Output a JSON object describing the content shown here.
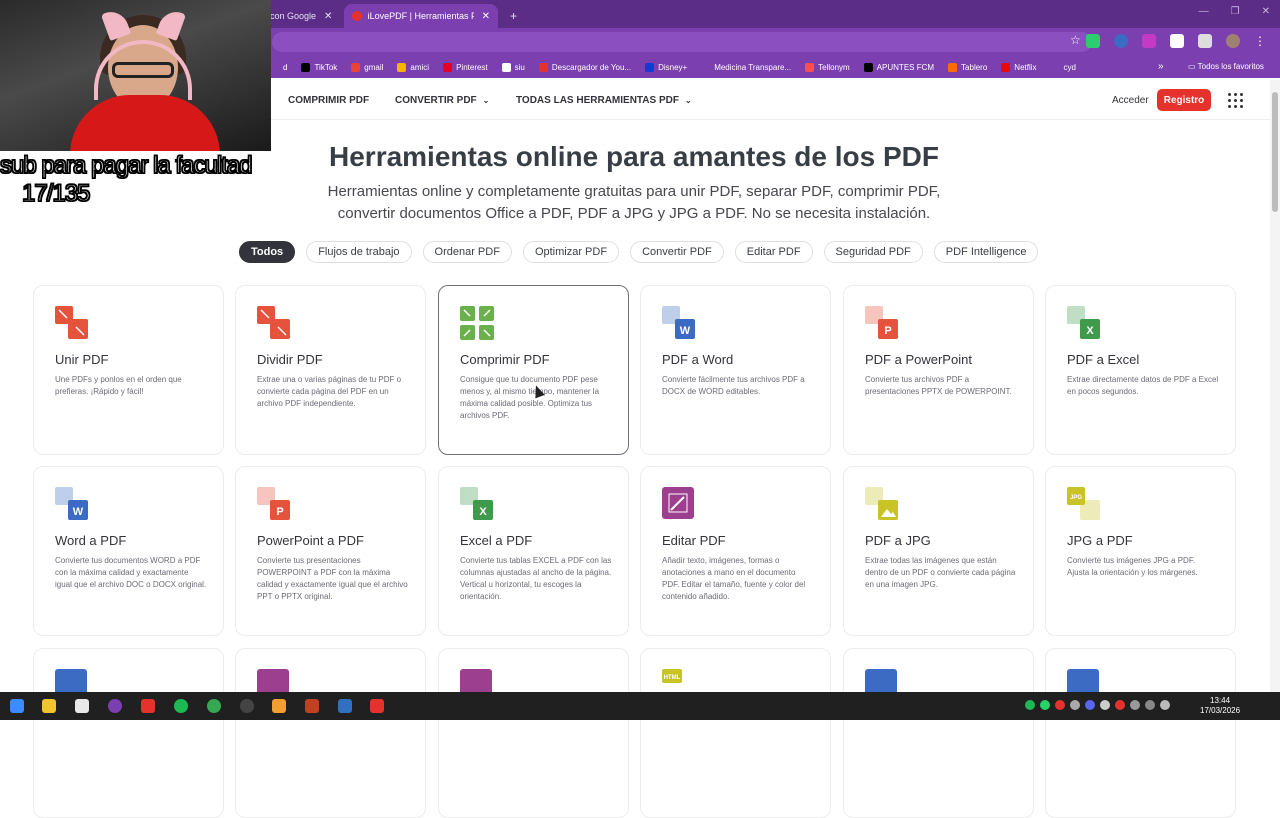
{
  "browser": {
    "tabs": [
      {
        "label": "con Google",
        "active": false
      },
      {
        "label": "iLovePDF | Herramientas PDF o",
        "active": true
      }
    ],
    "new_tab": "+",
    "close": "✕",
    "bookmarks": [
      {
        "label": "d",
        "color": "#7b3fb0"
      },
      {
        "label": "TikTok",
        "color": "#000000"
      },
      {
        "label": "gmail",
        "color": "#ea4335"
      },
      {
        "label": "amici",
        "color": "#f4b400"
      },
      {
        "label": "Pinterest",
        "color": "#e60023"
      },
      {
        "label": "siu",
        "color": "#ffffff"
      },
      {
        "label": "Descargador de You...",
        "color": "#e5322d"
      },
      {
        "label": "Disney+",
        "color": "#113ccf"
      },
      {
        "label": "Medicina Transpare...",
        "color": "#7b3fb0"
      },
      {
        "label": "Tellonym",
        "color": "#ff4d4d"
      },
      {
        "label": "APUNTES FCM",
        "color": "#000000"
      },
      {
        "label": "Tablero",
        "color": "#ff6b00"
      },
      {
        "label": "Netflix",
        "color": "#e50914"
      },
      {
        "label": "cyd",
        "color": "#7b3fb0"
      }
    ],
    "bookmarks_more": "»",
    "all_favorites": "Todos los favoritos"
  },
  "overlay": {
    "line1": "sub para pagar la facultad",
    "line2": "17/135"
  },
  "nav": {
    "compress": "COMPRIMIR PDF",
    "convert": "CONVERTIR PDF",
    "all_tools": "TODAS LAS HERRAMIENTAS PDF",
    "login": "Acceder",
    "register": "Registro"
  },
  "hero": {
    "title": "Herramientas online para amantes de los PDF",
    "subtitle": "Herramientas online y completamente gratuitas para unir PDF, separar PDF, comprimir PDF, convertir documentos Office a PDF, PDF a JPG y JPG a PDF. No se necesita instalación."
  },
  "filters": [
    "Todos",
    "Flujos de trabajo",
    "Ordenar PDF",
    "Optimizar PDF",
    "Convertir PDF",
    "Editar PDF",
    "Seguridad PDF",
    "PDF Intelligence"
  ],
  "tools": [
    {
      "title": "Unir PDF",
      "desc": "Une PDFs y ponlos en el orden que prefieras. ¡Rápido y fácil!",
      "icon": "merge-icon",
      "color": "#e5533d"
    },
    {
      "title": "Dividir PDF",
      "desc": "Extrae una o varias páginas de tu PDF o convierte cada página del PDF en un archivo PDF independiente.",
      "icon": "split-icon",
      "color": "#e5533d"
    },
    {
      "title": "Comprimir PDF",
      "desc": "Consigue que tu documento PDF pese menos y, al mismo tiempo, mantener la máxima calidad posible. Optimiza tus archivos PDF.",
      "icon": "compress-icon",
      "color": "#6ab04c"
    },
    {
      "title": "PDF a Word",
      "desc": "Convierte fácilmente tus archivos PDF a DOCX de WORD editables.",
      "icon": "word-icon",
      "color": "#3b6bc2"
    },
    {
      "title": "PDF a PowerPoint",
      "desc": "Convierte tus archivos PDF a presentaciones PPTX de POWERPOINT.",
      "icon": "powerpoint-icon",
      "color": "#e5533d"
    },
    {
      "title": "PDF a Excel",
      "desc": "Extrae directamente datos de PDF a Excel en pocos segundos.",
      "icon": "excel-icon",
      "color": "#3f9b4b"
    },
    {
      "title": "Word a PDF",
      "desc": "Convierte tus documentos WORD a PDF con la máxima calidad y exactamente igual que el archivo DOC o DOCX original.",
      "icon": "word-icon",
      "color": "#3b6bc2"
    },
    {
      "title": "PowerPoint a PDF",
      "desc": "Convierte tus presentaciones POWERPOINT a PDF con la máxima calidad y exactamente igual que el archivo PPT o PPTX original.",
      "icon": "powerpoint-icon",
      "color": "#e5533d"
    },
    {
      "title": "Excel a PDF",
      "desc": "Convierte tus tablas EXCEL a PDF con las columnas ajustadas al ancho de la página. Vertical u horizontal, tu escoges la orientación.",
      "icon": "excel-icon",
      "color": "#3f9b4b"
    },
    {
      "title": "Editar PDF",
      "desc": "Añadir texto, imágenes, formas o anotaciones a mano en el documento PDF. Editar el tamaño, fuente y color del contenido añadido.",
      "icon": "edit-icon",
      "color": "#9b3f8e"
    },
    {
      "title": "PDF a JPG",
      "desc": "Extrae todas las imágenes que están dentro de un PDF o convierte cada página en una imagen JPG.",
      "icon": "image-icon",
      "color": "#c9c326"
    },
    {
      "title": "JPG a PDF",
      "desc": "Convierte tus imágenes JPG a PDF. Ajusta la orientación y los márgenes.",
      "icon": "jpg-icon",
      "color": "#c9c326"
    },
    {
      "title": "",
      "desc": "",
      "icon": "sign-icon",
      "color": "#3b6bc2"
    },
    {
      "title": "",
      "desc": "",
      "icon": "stamp-icon",
      "color": "#9b3f8e"
    },
    {
      "title": "",
      "desc": "",
      "icon": "rotate-icon",
      "color": "#9b3f8e"
    },
    {
      "title": "",
      "desc": "",
      "icon": "html-icon",
      "color": "#c9c326"
    },
    {
      "title": "",
      "desc": "",
      "icon": "lock-icon",
      "color": "#3b6bc2"
    },
    {
      "title": "",
      "desc": "",
      "icon": "shield-icon",
      "color": "#3b6bc2"
    }
  ],
  "taskbar": {
    "time": "13:44",
    "date": "17/03/2026"
  }
}
